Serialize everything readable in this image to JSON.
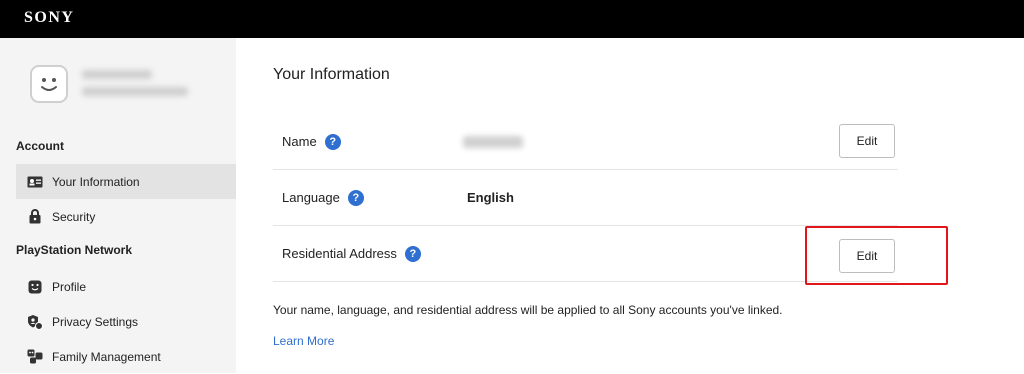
{
  "header": {
    "logo": "SONY"
  },
  "sidebar": {
    "sections": [
      {
        "title": "Account",
        "items": [
          {
            "label": "Your Information",
            "icon": "id-card-icon",
            "active": true
          },
          {
            "label": "Security",
            "icon": "lock-icon",
            "active": false
          }
        ]
      },
      {
        "title": "PlayStation Network",
        "items": [
          {
            "label": "Profile",
            "icon": "smiley-icon",
            "active": false
          },
          {
            "label": "Privacy Settings",
            "icon": "shield-user-icon",
            "active": false
          },
          {
            "label": "Family Management",
            "icon": "family-icon",
            "active": false
          }
        ]
      }
    ]
  },
  "main": {
    "title": "Your Information",
    "rows": [
      {
        "label": "Name",
        "value": "",
        "edit_label": "Edit"
      },
      {
        "label": "Language",
        "value": "English",
        "edit_label": ""
      },
      {
        "label": "Residential Address",
        "value": "",
        "edit_label": "Edit"
      }
    ],
    "help_glyph": "?",
    "note": "Your name, language, and residential address will be applied to all Sony accounts you've linked.",
    "learn_more": "Learn More"
  },
  "colors": {
    "accent": "#2f6fd0",
    "highlight": "#e0161b",
    "topbar": "#000000"
  }
}
